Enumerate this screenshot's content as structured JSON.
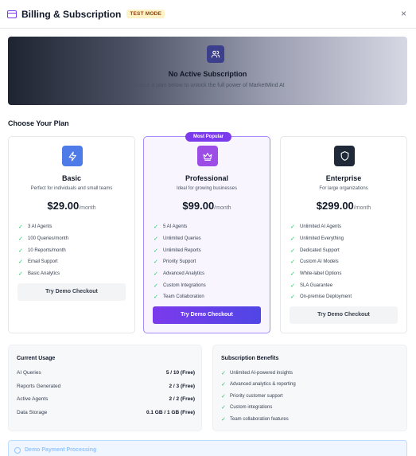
{
  "header": {
    "title": "Billing & Subscription",
    "badge": "TEST MODE",
    "close": "×"
  },
  "hero": {
    "title": "No Active Subscription",
    "subtitle": "Choose a plan below to unlock the full power of MarketMind AI"
  },
  "plans_section_title": "Choose Your Plan",
  "plans": [
    {
      "name": "Basic",
      "description": "Perfect for individuals and small teams",
      "price": "$29.00",
      "period": "/month",
      "icon": "bolt-icon",
      "icon_color": "#4f7be8",
      "features": [
        "3 AI Agents",
        "100 Queries/month",
        "10 Reports/month",
        "Email Support",
        "Basic Analytics"
      ],
      "button": "Try Demo Checkout"
    },
    {
      "name": "Professional",
      "badge": "Most Popular",
      "description": "Ideal for growing businesses",
      "price": "$99.00",
      "period": "/month",
      "icon": "crown-icon",
      "icon_color": "#9b4de6",
      "features": [
        "5 AI Agents",
        "Unlimited Queries",
        "Unlimited Reports",
        "Priority Support",
        "Advanced Analytics",
        "Custom Integrations",
        "Team Collaboration"
      ],
      "button": "Try Demo Checkout"
    },
    {
      "name": "Enterprise",
      "description": "For large organizations",
      "price": "$299.00",
      "period": "/month",
      "icon": "shield-icon",
      "icon_color": "#1f2937",
      "features": [
        "Unlimited AI Agents",
        "Unlimited Everything",
        "Dedicated Support",
        "Custom AI Models",
        "White-label Options",
        "SLA Guarantee",
        "On-premise Deployment"
      ],
      "button": "Try Demo Checkout"
    }
  ],
  "usage": {
    "title": "Current Usage",
    "rows": [
      {
        "label": "AI Queries",
        "value": "5 / 10 (Free)"
      },
      {
        "label": "Reports Generated",
        "value": "2 / 3 (Free)"
      },
      {
        "label": "Active Agents",
        "value": "2 / 2 (Free)"
      },
      {
        "label": "Data Storage",
        "value": "0.1 GB / 1 GB (Free)"
      }
    ]
  },
  "benefits": {
    "title": "Subscription Benefits",
    "items": [
      "Unlimited AI-powered insights",
      "Advanced analytics & reporting",
      "Priority customer support",
      "Custom integrations",
      "Team collaboration features"
    ]
  },
  "processing": {
    "label": "Demo Payment Processing"
  },
  "colors": {
    "accent": "#7c3aed",
    "check": "#22c55e"
  }
}
